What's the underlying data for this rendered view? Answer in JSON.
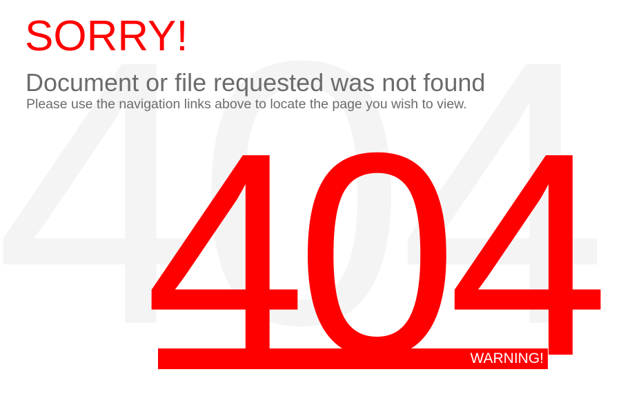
{
  "background_code": "404",
  "title": "SORRY!",
  "heading": "Document or file requested was not found",
  "subtext": "Please use the navigation links above to locate the page you wish to view.",
  "error_code": "404",
  "warning_label": "WARNING!",
  "colors": {
    "accent": "#ff0000",
    "text_gray": "#6b6b6b",
    "watermark": "#f4f4f4",
    "background": "#ffffff"
  }
}
